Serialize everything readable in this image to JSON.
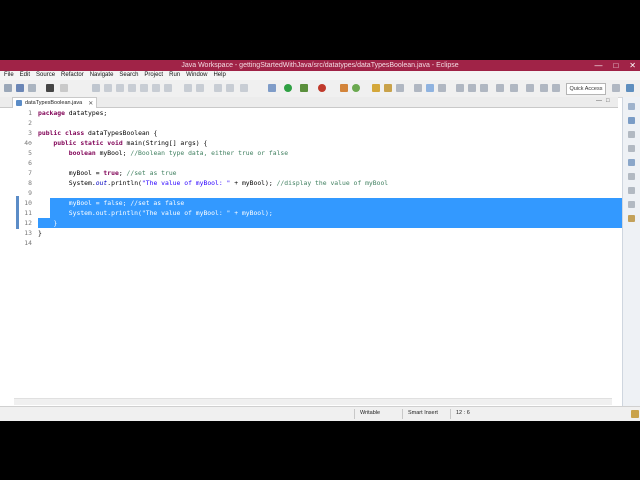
{
  "window": {
    "title": "Java Workspace - gettingStartedWithJava/src/datatypes/dataTypesBoolean.java - Eclipse"
  },
  "menu": [
    "File",
    "Edit",
    "Source",
    "Refactor",
    "Navigate",
    "Search",
    "Project",
    "Run",
    "Window",
    "Help"
  ],
  "toolbar": {
    "quick_access": "Quick Access"
  },
  "editor_tab": {
    "label": "dataTypesBoolean.java"
  },
  "code": [
    {
      "n": "1",
      "text": "package datatypes;"
    },
    {
      "n": "2",
      "text": ""
    },
    {
      "n": "3",
      "text": "public class dataTypesBoolean {"
    },
    {
      "n": "4⊖",
      "text": "    public static void main(String[] args) {"
    },
    {
      "n": "5",
      "text": "        boolean myBool; //Boolean type data, either true or false"
    },
    {
      "n": "6",
      "text": ""
    },
    {
      "n": "7",
      "text": "        myBool = true; //set as true"
    },
    {
      "n": "8",
      "text": "        System.out.println(\"The value of myBool: \" + myBool); //display the value of myBool"
    },
    {
      "n": "9",
      "text": ""
    },
    {
      "n": "10",
      "text": "        myBool = false; //set as false"
    },
    {
      "n": "11",
      "text": "        System.out.println(\"The value of myBool: \" + myBool);"
    },
    {
      "n": "12",
      "text": "    }"
    },
    {
      "n": "13",
      "text": "}"
    },
    {
      "n": "14",
      "text": ""
    }
  ],
  "status": {
    "mode": "Writable",
    "insert": "Smart Insert",
    "position": "12 : 6"
  },
  "colors": {
    "titlebar": "#a02347",
    "selection": "#3399ff",
    "keyword": "#7f0055",
    "comment": "#3f7f5f",
    "string": "#2a00ff"
  }
}
